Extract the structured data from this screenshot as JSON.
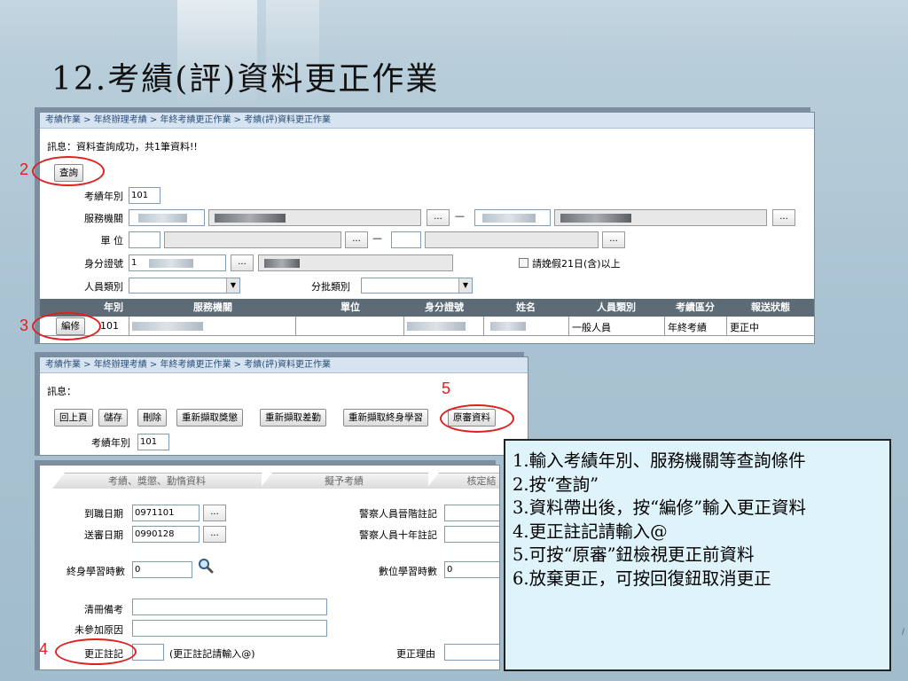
{
  "slide": {
    "title": "12.考績(評)資料更正作業"
  },
  "panel1": {
    "breadcrumb": "考績作業 > 年終辦理考績 > 年終考績更正作業 > 考績(評)資料更正作業",
    "message": "訊息：資料查詢成功，共1筆資料!!",
    "query_button": "查詢",
    "year_label": "考績年別",
    "year_value": "101",
    "agency_label": "服務機關",
    "unit_label": "單 位",
    "id_label": "身分證號",
    "id_prefix": "1",
    "dots": "...",
    "dash": "—",
    "leave_checkbox_label": "請娩假21日(含)以上",
    "person_type_label": "人員類別",
    "batch_type_label": "分批類別",
    "table": {
      "headers": [
        "年別",
        "服務機關",
        "單位",
        "身分證號",
        "姓名",
        "人員類別",
        "考績區分",
        "報送狀態"
      ],
      "edit_button": "編修",
      "row": {
        "year": "101",
        "person_type": "一般人員",
        "category": "年終考績",
        "status": "更正中"
      }
    }
  },
  "panel2": {
    "breadcrumb": "考績作業 > 年終辦理考績 > 年終考績更正作業 > 考績(評)資料更正作業",
    "message": "訊息：",
    "buttons": {
      "prev": "回上頁",
      "save": "儲存",
      "delete": "刪除",
      "refetch_reward": "重新擷取獎懲",
      "refetch_leave": "重新擷取差勤",
      "refetch_learning": "重新擷取終身學習",
      "original": "原審資料"
    },
    "year_label": "考績年別",
    "year_value": "101"
  },
  "panel3": {
    "tabs": [
      "考績、獎懲、勤惰資料",
      "擬予考績",
      "核定結"
    ],
    "hire_date_label": "到職日期",
    "hire_date_value": "0971101",
    "submit_date_label": "送審日期",
    "submit_date_value": "0990128",
    "police_promo_label": "警察人員晉階註記",
    "police_ten_label": "警察人員十年註記",
    "lifelong_hours_label": "終身學習時數",
    "lifelong_hours_value": "0",
    "digital_hours_label": "數位學習時數",
    "digital_hours_value": "0",
    "roster_note_label": "清冊備考",
    "absent_reason_label": "未參加原因",
    "correction_note_label": "更正註記",
    "correction_note_hint": "(更正註記請輸入@)",
    "correction_reason_label": "更正理由",
    "dots": "..."
  },
  "annotations": {
    "n2": "2",
    "n3": "3",
    "n4": "4",
    "n5": "5"
  },
  "notes": [
    "1.輸入考績年別、服務機關等查詢條件",
    "2.按“查詢”",
    "3.資料帶出後，按“編修”輸入更正資料",
    "4.更正註記請輸入@",
    "5.可按“原審”鈕檢視更正前資料",
    "6.放棄更正，可按回復鈕取消更正"
  ],
  "slide_number": "/",
  "colors": {
    "highlight": "#e02020",
    "note_bg": "#dff3fb",
    "table_header": "#5d6b76",
    "breadcrumb_text": "#2a4f7a"
  },
  "icons": {
    "search": "magnifier-icon",
    "dropdown": "chevron-down-icon"
  }
}
